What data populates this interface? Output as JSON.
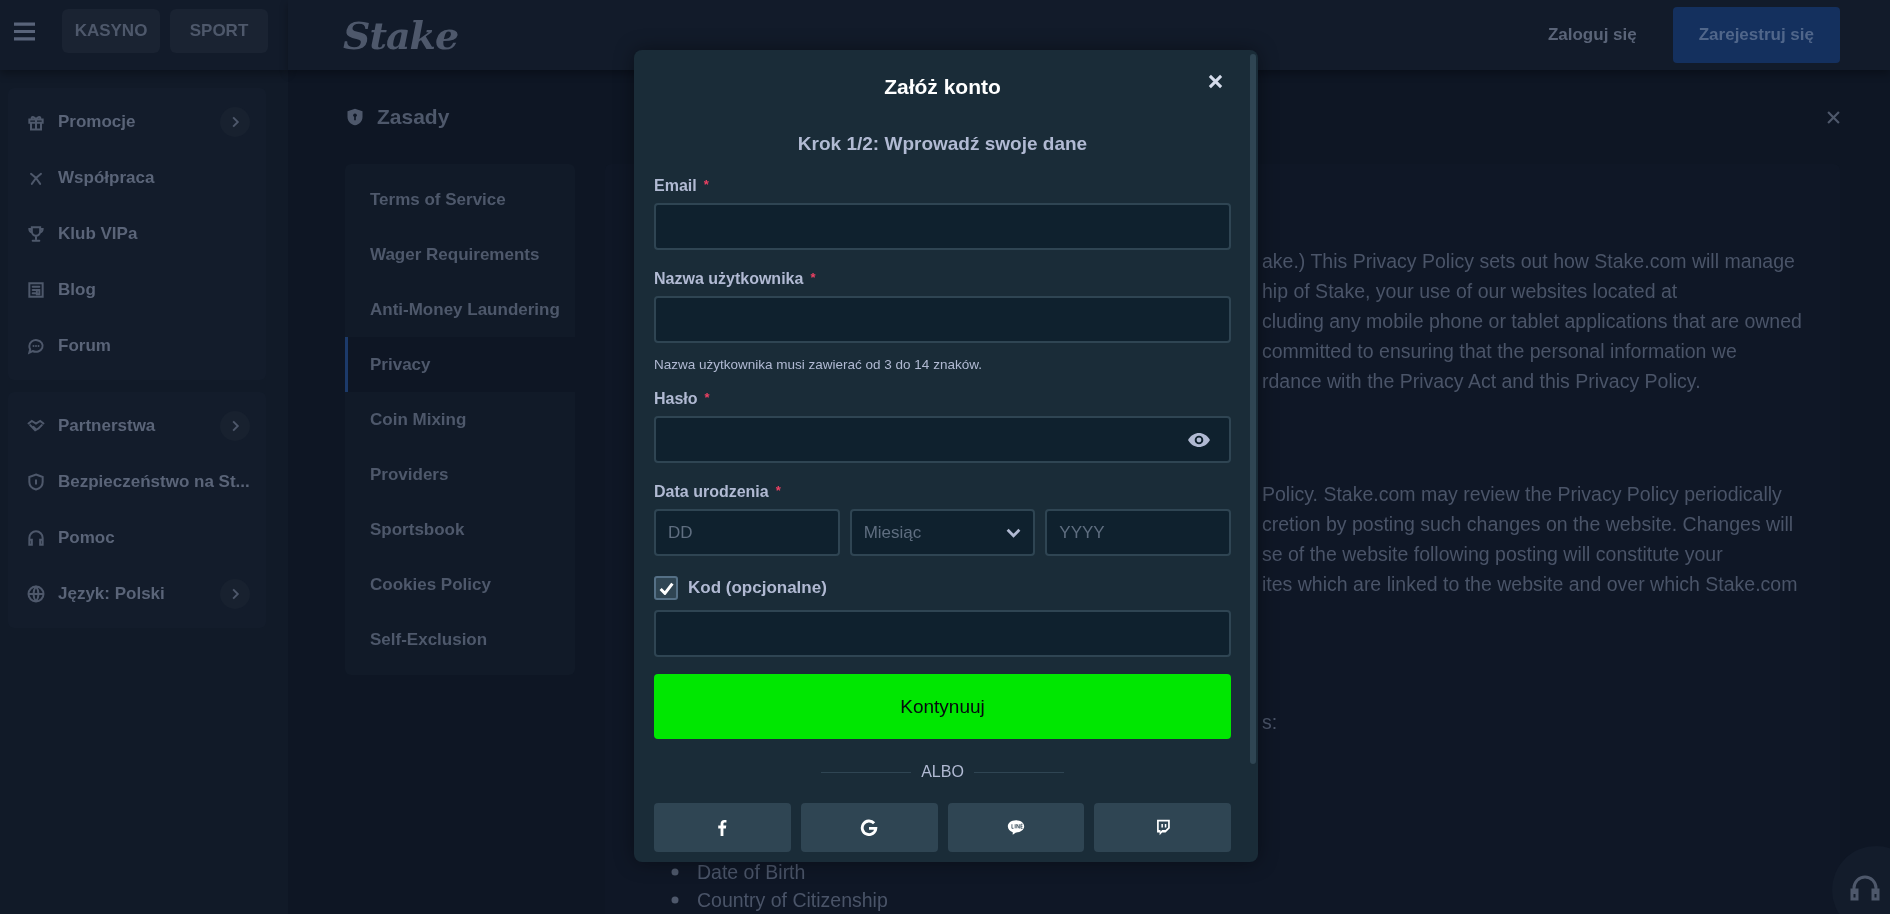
{
  "sidebar": {
    "tabs": [
      {
        "label": "KASYNO",
        "selected": false
      },
      {
        "label": "SPORT",
        "selected": false
      }
    ],
    "groups": [
      [
        {
          "label": "Promocje",
          "submenu": true
        },
        {
          "label": "Współpraca",
          "submenu": false
        },
        {
          "label": "Klub VIPa",
          "submenu": false
        },
        {
          "label": "Blog",
          "submenu": false
        },
        {
          "label": "Forum",
          "submenu": false
        }
      ],
      [
        {
          "label": "Partnerstwa",
          "submenu": true
        },
        {
          "label": "Bezpieczeństwo na St...",
          "submenu": false
        },
        {
          "label": "Pomoc",
          "submenu": false
        },
        {
          "label": "Język: Polski",
          "submenu": true
        }
      ]
    ]
  },
  "top_bar": {
    "logo": "Stake",
    "login": "Zaloguj się",
    "register": "Zarejestruj się"
  },
  "page": {
    "title": "Zasady",
    "nav": [
      {
        "label": "Terms of Service",
        "selected": false
      },
      {
        "label": "Wager Requirements",
        "selected": false
      },
      {
        "label": "Anti-Money Laundering",
        "selected": false
      },
      {
        "label": "Privacy",
        "selected": true
      },
      {
        "label": "Coin Mixing",
        "selected": false
      },
      {
        "label": "Providers",
        "selected": false
      },
      {
        "label": "Sportsbook",
        "selected": false
      },
      {
        "label": "Cookies Policy",
        "selected": false
      },
      {
        "label": "Self-Exclusion",
        "selected": false
      }
    ],
    "paragraphs": [
      [
        "ake.) This Privacy Policy sets out how Stake.com will manage",
        "hip of Stake, your use of our websites located at",
        "cluding any mobile phone or tablet applications that are owned",
        "committed to ensuring that the personal information we",
        "rdance with the Privacy Act and this Privacy Policy."
      ],
      [
        "Policy. Stake.com may review the Privacy Policy periodically",
        "cretion by posting such changes on the website. Changes will",
        "se of the website following posting will constitute your",
        "ites which are linked to the website and over which Stake.com"
      ],
      [
        "s:"
      ]
    ],
    "list": [
      "Date of Birth",
      "Country of Citizenship"
    ]
  },
  "modal": {
    "title": "Załóż konto",
    "step": "Krok 1/2: Wprowadź swoje dane",
    "fields": [
      {
        "kind": "text",
        "label": "Email",
        "required_mark": "*"
      },
      {
        "kind": "text",
        "label": "Nazwa użytkownika",
        "required_mark": "*",
        "hint": "Nazwa użytkownika musi zawierać od 3 do 14 znaków."
      },
      {
        "kind": "password",
        "label": "Hasło",
        "required_mark": "*"
      },
      {
        "kind": "date",
        "label": "Data urodzenia",
        "required_mark": "*",
        "parts": [
          {
            "kind": "input",
            "placeholder": "DD"
          },
          {
            "kind": "select",
            "placeholder": "Miesiąc"
          },
          {
            "kind": "input",
            "placeholder": "YYYY"
          }
        ]
      }
    ],
    "code": {
      "label": "Kod (opcjonalne)",
      "checked": true
    },
    "submit": "Kontynuuj",
    "divider": "ALBO"
  }
}
